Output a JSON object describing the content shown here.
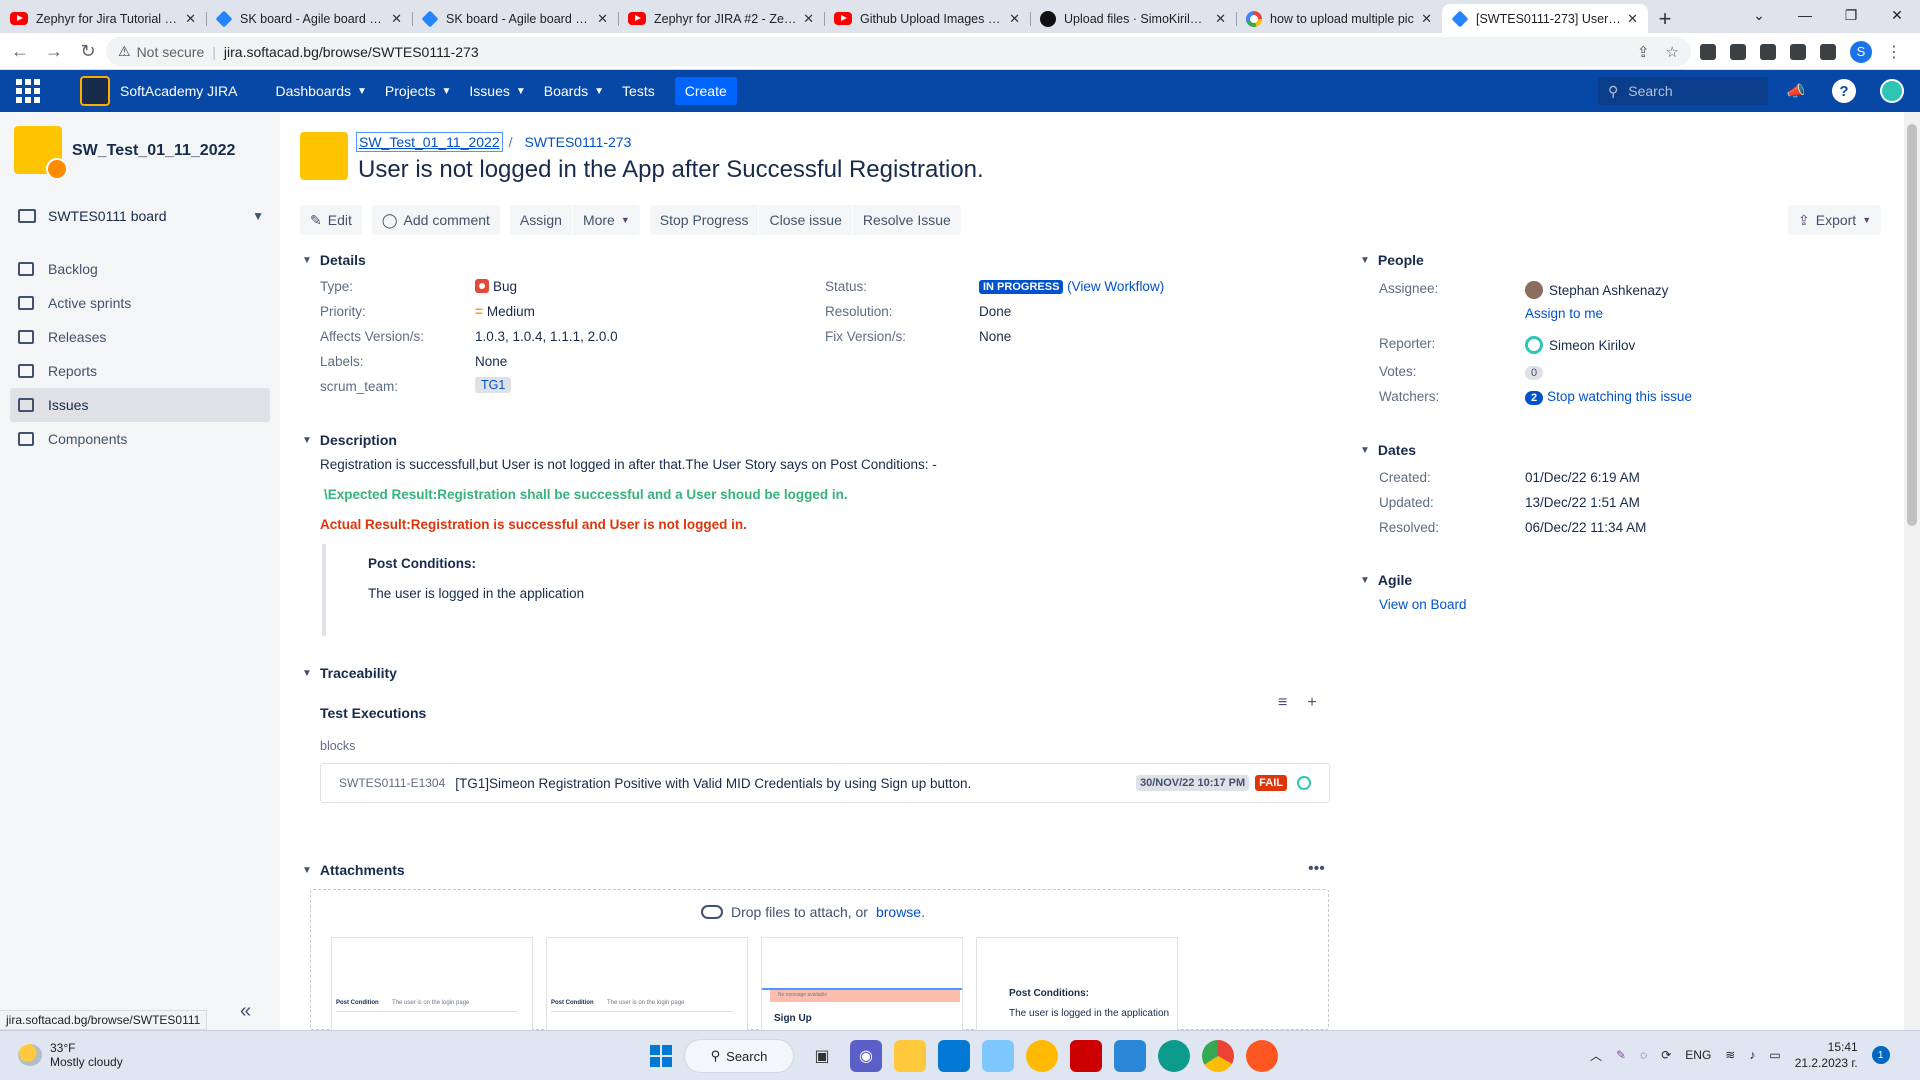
{
  "browser": {
    "tabs": [
      {
        "title": "Zephyr for Jira Tutorial - Te",
        "favicon": "youtube-icon"
      },
      {
        "title": "SK board - Agile board - Ji",
        "favicon": "jira-icon"
      },
      {
        "title": "SK board - Agile board - Ji",
        "favicon": "jira-icon"
      },
      {
        "title": "Zephyr for JIRA #2 - Zephy",
        "favicon": "youtube-icon"
      },
      {
        "title": "Github Upload Images (20",
        "favicon": "youtube-icon"
      },
      {
        "title": "Upload files · SimoKirilov/I",
        "favicon": "github-icon"
      },
      {
        "title": "how to upload multiple pic",
        "favicon": "google-icon"
      },
      {
        "title": "[SWTES0111-273] User is n",
        "favicon": "jira-icon"
      }
    ],
    "new_tab": "+",
    "security": "Not secure",
    "url": "jira.softacad.bg/browse/SWTES0111-273",
    "profile_initial": "S",
    "status_url": "jira.softacad.bg/browse/SWTES0111"
  },
  "header": {
    "app_name": "SoftAcademy JIRA",
    "nav": [
      "Dashboards",
      "Projects",
      "Issues",
      "Boards",
      "Tests"
    ],
    "create": "Create",
    "search_placeholder": "Search",
    "help": "?"
  },
  "sidebar": {
    "project_name": "SW_Test_01_11_2022",
    "board": "SWTES0111 board",
    "items": [
      {
        "label": "Backlog",
        "icon": "backlog-icon"
      },
      {
        "label": "Active sprints",
        "icon": "board-icon"
      },
      {
        "label": "Releases",
        "icon": "ship-icon"
      },
      {
        "label": "Reports",
        "icon": "chart-icon"
      },
      {
        "label": "Issues",
        "icon": "issues-icon"
      },
      {
        "label": "Components",
        "icon": "puzzle-icon"
      }
    ],
    "collapse": "«"
  },
  "issue": {
    "project_crumb": "SW_Test_01_11_2022",
    "crumb_sep": "/",
    "key": "SWTES0111-273",
    "summary": "User is not logged in the App after Successful Registration.",
    "toolbar": {
      "edit": "Edit",
      "comment": "Add comment",
      "assign": "Assign",
      "more": "More",
      "stop": "Stop Progress",
      "close": "Close issue",
      "resolve": "Resolve Issue",
      "export": "Export"
    },
    "details": {
      "heading": "Details",
      "type_label": "Type:",
      "type": "Bug",
      "priority_label": "Priority:",
      "priority": "Medium",
      "affects_label": "Affects Version/s:",
      "affects": "1.0.3, 1.0.4, 1.1.1, 2.0.0",
      "labels_label": "Labels:",
      "labels": "None",
      "team_label": "scrum_team:",
      "team": "TG1",
      "status_label": "Status:",
      "status": "IN PROGRESS",
      "workflow": "(View Workflow)",
      "resolution_label": "Resolution:",
      "resolution": "Done",
      "fix_label": "Fix Version/s:",
      "fix": "None"
    },
    "description": {
      "heading": "Description",
      "line1": "Registration is successfull,but User is not logged in after that.The User Story says on Post Conditions: -",
      "expected": "\\Expected Result:Registration shall be successful and a User shoud be logged in.",
      "actual": "Actual Result:Registration is successful and User is not logged in.",
      "quote_heading": "Post Conditions:",
      "quote_body": "The user is logged in the application"
    },
    "traceability": {
      "heading": "Traceability",
      "sub": "Test Executions",
      "relation": "blocks",
      "exec_key": "SWTES0111-E1304",
      "exec_title": "[TG1]Simeon Registration Positive with Valid MID Credentials by using Sign up button.",
      "exec_date": "30/NOV/22 10:17 PM",
      "exec_status": "FAIL"
    },
    "attachments": {
      "heading": "Attachments",
      "drop": "Drop files to attach, or",
      "browse": "browse.",
      "thumbs": [
        {
          "title": "Post Condition",
          "text": "The user is on the login page"
        },
        {
          "title": "Post Condition",
          "text": "The user is on the login page"
        },
        {
          "title": "Sign Up",
          "text": "No message available"
        },
        {
          "title": "Post Conditions:",
          "text": "The user is logged in the application"
        }
      ]
    },
    "people": {
      "heading": "People",
      "assignee_label": "Assignee:",
      "assignee": "Stephan Ashkenazy",
      "assign_me": "Assign to me",
      "reporter_label": "Reporter:",
      "reporter": "Simeon Kirilov",
      "votes_label": "Votes:",
      "votes": "0",
      "watchers_label": "Watchers:",
      "watchers": "2",
      "watch_action": "Stop watching this issue"
    },
    "dates": {
      "heading": "Dates",
      "created_label": "Created:",
      "created": "01/Dec/22 6:19 AM",
      "updated_label": "Updated:",
      "updated": "13/Dec/22 1:51 AM",
      "resolved_label": "Resolved:",
      "resolved": "06/Dec/22 11:34 AM"
    },
    "agile": {
      "heading": "Agile",
      "link": "View on Board"
    }
  },
  "taskbar": {
    "temp": "33°F",
    "weather": "Mostly cloudy",
    "search": "Search",
    "lang": "ENG",
    "time": "15:41",
    "date": "21.2.2023 г.",
    "notif": "1"
  },
  "colors": {
    "jira_header": "#0747a6",
    "link": "#0052cc",
    "expected_green": "#36b37e",
    "actual_red": "#de350b"
  }
}
